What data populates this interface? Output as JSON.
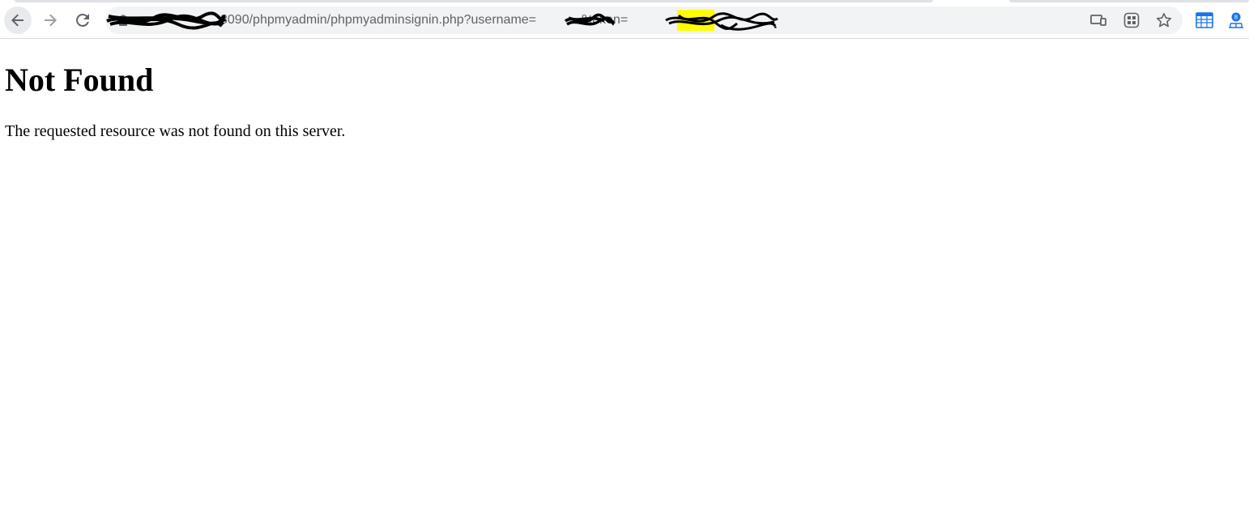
{
  "browser": {
    "url_visible_part1": "8090/phpmyadmin/phpmyadminsignin.php?username=",
    "url_visible_part2": "&token=",
    "colors": {
      "toolbar_bg": "#ffffff",
      "omnibox_bg": "#f1f3f4",
      "icon_color": "#5f6368",
      "ext_blue": "#1a73e8",
      "highlight_yellow": "#ffff00"
    },
    "icons": [
      "back-arrow-icon",
      "forward-arrow-icon",
      "reload-icon",
      "lock-icon",
      "cast-devices-icon",
      "qr-grid-icon",
      "bookmark-star-icon",
      "calendar-extension-icon",
      "profile-extension-icon"
    ]
  },
  "page": {
    "heading": "Not Found",
    "message": "The requested resource was not found on this server."
  }
}
